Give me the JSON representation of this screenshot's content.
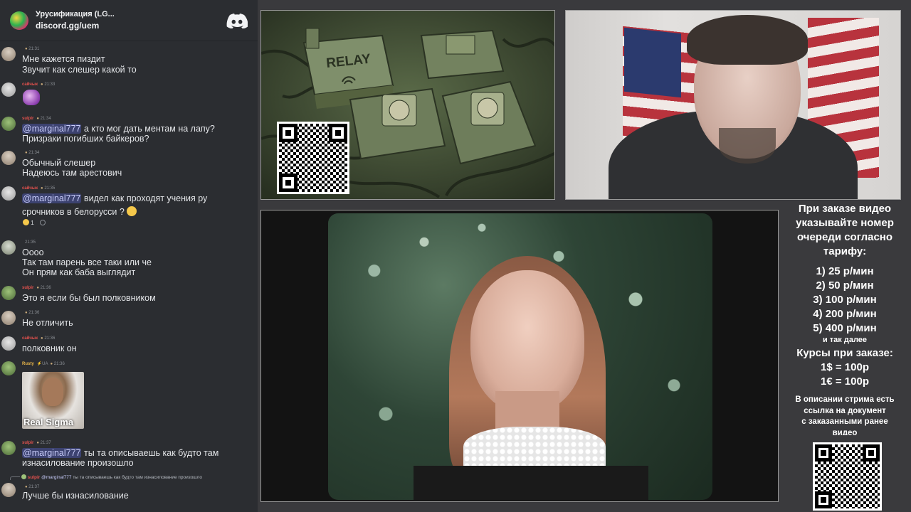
{
  "server": {
    "name": "Урусификация (LG...",
    "invite": "discord.gg/uem"
  },
  "chat": [
    {
      "author": "",
      "time": "21:31",
      "color": "gray",
      "lines": [
        "Мне кажется пиздит",
        "Звучит как слешер какой то"
      ]
    },
    {
      "author": "сайчык",
      "time": "21:33",
      "color": "red",
      "lines": []
    },
    {
      "author": "sulpir",
      "time": "21:34",
      "color": "red",
      "mention": "@marginal777",
      "lines": [
        "а кто мог дать ментам на лапу?",
        "Призраки погибших байкеров?"
      ]
    },
    {
      "author": "",
      "time": "21:34",
      "color": "gray",
      "lines": [
        "Обычный слешер",
        "Надеюсь там арестович"
      ]
    },
    {
      "author": "сайчык",
      "time": "21:35",
      "color": "red",
      "mention": "@marginal777",
      "lines": [
        "видел как проходят учения ру",
        "срочников в белорусси ?"
      ],
      "reaction": "1"
    },
    {
      "author": "",
      "time": "21:35",
      "color": "gray",
      "lines": [
        "Оооо",
        "Так там парень все таки или че",
        "Он прям как баба выглядит"
      ]
    },
    {
      "author": "sulpir",
      "time": "21:36",
      "color": "red",
      "lines": [
        "Это я если бы был полковником"
      ]
    },
    {
      "author": "",
      "time": "21:36",
      "color": "gray",
      "lines": [
        "Не отличить"
      ]
    },
    {
      "author": "сайчык",
      "time": "21:36",
      "color": "red",
      "lines": [
        "полковник он"
      ]
    },
    {
      "author": "Rusty",
      "badge": "UA",
      "time": "21:36",
      "color": "amber",
      "lines": [],
      "image_caption": "Real Sigma"
    },
    {
      "author": "sulpir",
      "time": "21:37",
      "color": "red",
      "mention": "@marginal777",
      "lines": [
        "ты та описываешь как будто там",
        "изнасилование произошло"
      ]
    },
    {
      "author": "",
      "time": "21:37",
      "color": "gray",
      "reply_mention": "@marginal777",
      "reply_text": "ты та описываешь как будто там изнасилование произошло",
      "lines": [
        "Лучше бы изнасилование"
      ]
    }
  ],
  "relay_image": {
    "label": "RELAY"
  },
  "info": {
    "heading": [
      "При заказе видео",
      "указывайте номер",
      "очереди согласно",
      "тарифу:"
    ],
    "tariffs": [
      "1) 25 р/мин",
      "2) 50 р/мин",
      "3) 100 р/мин",
      "4) 200 р/мин",
      "5) 400 р/мин"
    ],
    "tariffs_more": "и так далее",
    "rates_heading": "Курсы при заказе:",
    "rates": [
      "1$ = 100р",
      "1€ = 100р"
    ],
    "note": [
      "В описании стрима есть",
      "ссылка на документ",
      "с заказанными ранее",
      "видео"
    ]
  },
  "colors": {
    "chat_bg": "#2b2d31",
    "mention_bg": "#3c4270",
    "mention_fg": "#c9cdfb",
    "name_red": "#e2514d",
    "name_amber": "#e8b54a"
  }
}
